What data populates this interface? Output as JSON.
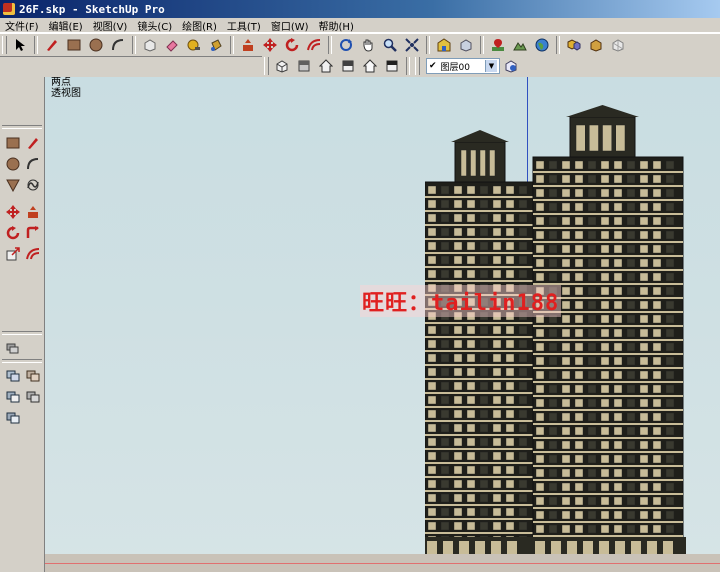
{
  "window": {
    "title": "26F.skp - SketchUp Pro"
  },
  "menu": [
    "文件(F)",
    "编辑(E)",
    "视图(V)",
    "镜头(C)",
    "绘图(R)",
    "工具(T)",
    "窗口(W)",
    "帮助(H)"
  ],
  "layer_toolbar": {
    "checked": "✔",
    "current_layer": "图层00"
  },
  "viewport": {
    "scene_tab": "两点",
    "camera_mode": "透视图",
    "watermark": "旺旺：tailin188"
  },
  "colors": {
    "window_bg": "#d4d0c8",
    "sky": "#cfe0e3",
    "building": "#c8bc98",
    "red_axis": "#e07070",
    "blue_axis": "#3050c0"
  }
}
